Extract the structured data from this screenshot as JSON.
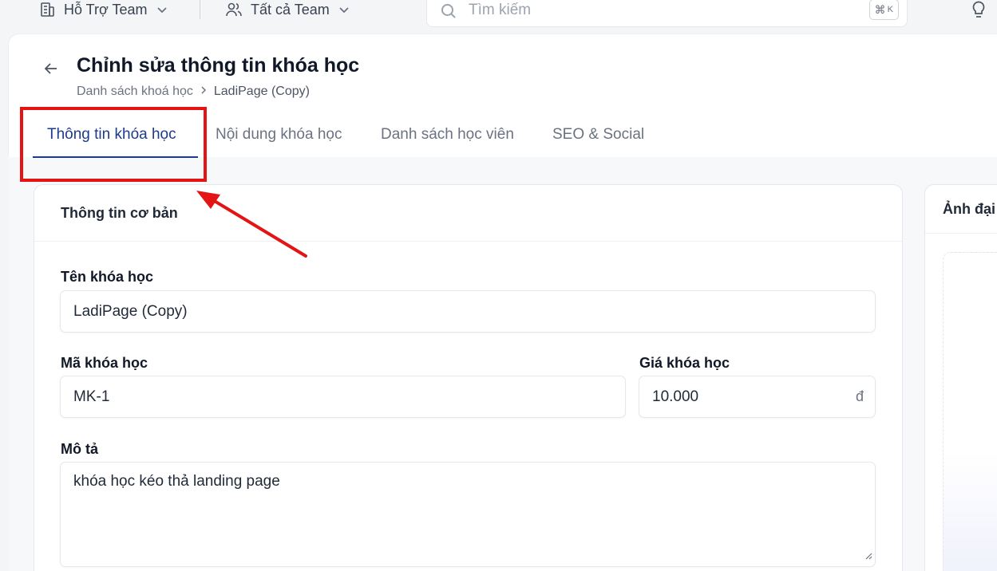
{
  "topbar": {
    "team_label": "Hỗ Trợ Team",
    "members_label": "Tất cả Team",
    "search_placeholder": "Tìm kiếm",
    "shortcut_symbol": "⌘",
    "shortcut_key": "K"
  },
  "header": {
    "title": "Chỉnh sửa thông tin khóa học",
    "breadcrumb": [
      "Danh sách khoá học",
      "LadiPage (Copy)"
    ]
  },
  "tabs": [
    {
      "label": "Thông tin khóa học",
      "active": true
    },
    {
      "label": "Nội dung khóa học",
      "active": false
    },
    {
      "label": "Danh sách học viên",
      "active": false
    },
    {
      "label": "SEO & Social",
      "active": false
    }
  ],
  "basic_info": {
    "section_title": "Thông tin cơ bản",
    "name_label": "Tên khóa học",
    "name_value": "LadiPage (Copy)",
    "code_label": "Mã khóa học",
    "code_value": "MK-1",
    "price_label": "Giá khóa học",
    "price_value": "10.000",
    "price_unit": "đ",
    "desc_label": "Mô tả",
    "desc_value": "khóa học kéo thả landing page"
  },
  "side_panel": {
    "title": "Ảnh đại"
  },
  "colors": {
    "accent": "#1e3a8a",
    "annotation": "#e41414"
  },
  "icons": [
    "building-icon",
    "chevron-down-icon",
    "users-icon",
    "search-icon",
    "lightbulb-icon",
    "arrow-left-icon",
    "chevron-right-icon",
    "resize-grip-icon"
  ]
}
